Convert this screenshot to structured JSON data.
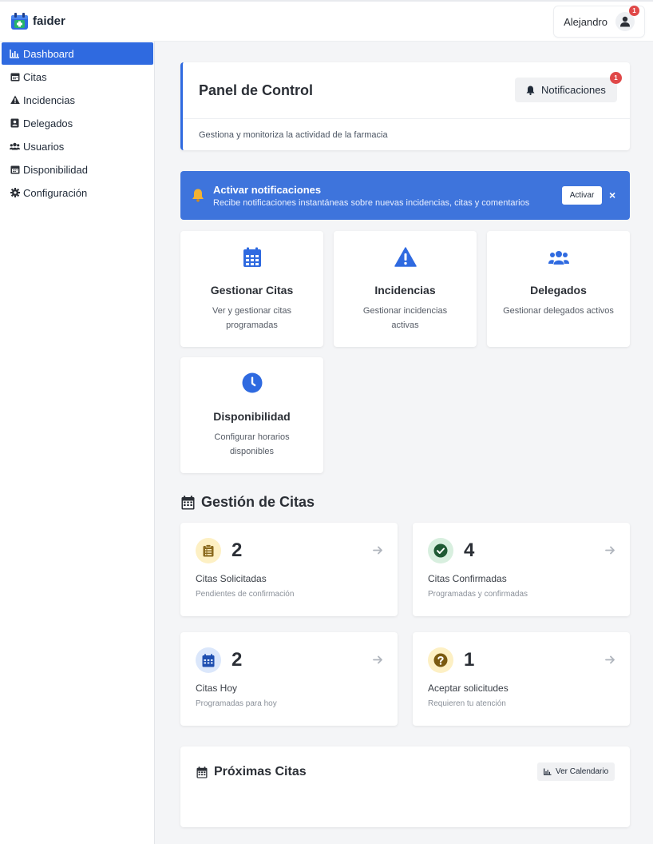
{
  "brand": {
    "name": "faider"
  },
  "user": {
    "name": "Alejandro",
    "badge": "1"
  },
  "sidebar": {
    "items": [
      {
        "label": "Dashboard",
        "icon": "chart-icon",
        "active": true
      },
      {
        "label": "Citas",
        "icon": "calendar-icon"
      },
      {
        "label": "Incidencias",
        "icon": "warning-icon"
      },
      {
        "label": "Delegados",
        "icon": "id-card-icon"
      },
      {
        "label": "Usuarios",
        "icon": "users-icon"
      },
      {
        "label": "Disponibilidad",
        "icon": "calendar-icon"
      },
      {
        "label": "Configuración",
        "icon": "gear-icon"
      }
    ]
  },
  "panel": {
    "title": "Panel de Control",
    "notifications_label": "Notificaciones",
    "notifications_badge": "1",
    "subtitle": "Gestiona y monitoriza la actividad de la farmacia"
  },
  "alert": {
    "title": "Activar notificaciones",
    "text": "Recibe notificaciones instantáneas sobre nuevas incidencias, citas y comentarios",
    "button": "Activar",
    "close": "×"
  },
  "tiles": [
    {
      "title": "Gestionar Citas",
      "desc": "Ver y gestionar citas programadas",
      "icon": "calendar-icon"
    },
    {
      "title": "Incidencias",
      "desc": "Gestionar incidencias activas",
      "icon": "warning-icon"
    },
    {
      "title": "Delegados",
      "desc": "Gestionar delegados activos",
      "icon": "users-icon"
    },
    {
      "title": "Disponibilidad",
      "desc": "Configurar horarios disponibles",
      "icon": "clock-icon"
    }
  ],
  "citas": {
    "title": "Gestión de Citas",
    "stats": [
      {
        "value": "2",
        "label": "Citas Solicitadas",
        "sub": "Pendientes de confirmación",
        "icon": "clipboard-icon",
        "bg": "#fdf0c4",
        "fg": "#8a6a1e"
      },
      {
        "value": "4",
        "label": "Citas Confirmadas",
        "sub": "Programadas y confirmadas",
        "icon": "check-circle-icon",
        "bg": "#d8efdf",
        "fg": "#1f5a34"
      },
      {
        "value": "2",
        "label": "Citas Hoy",
        "sub": "Programadas para hoy",
        "icon": "calendar-icon",
        "bg": "#dbe7fb",
        "fg": "#1f4fb0"
      },
      {
        "value": "1",
        "label": "Aceptar solicitudes",
        "sub": "Requieren tu atención",
        "icon": "question-circle-icon",
        "bg": "#fdf0c4",
        "fg": "#7a5a10"
      }
    ]
  },
  "proximas": {
    "title": "Próximas Citas",
    "button": "Ver Calendario"
  },
  "colors": {
    "primary": "#2f6ae0",
    "alert": "#3e74dc",
    "badge": "#e04848"
  }
}
